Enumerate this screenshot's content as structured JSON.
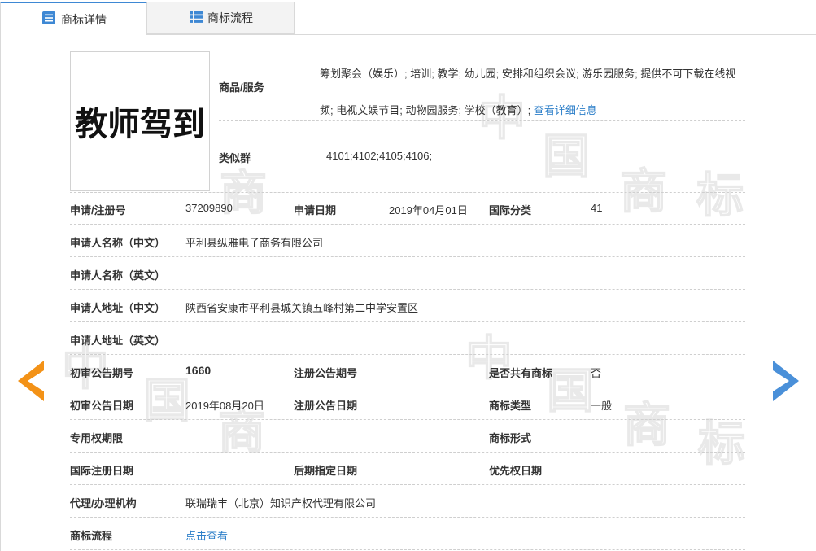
{
  "tabs": [
    {
      "label": "商标详情",
      "icon": "document-list-icon",
      "active": true
    },
    {
      "label": "商标流程",
      "icon": "list-icon",
      "active": false
    }
  ],
  "logo_text": "教师驾到",
  "goods": {
    "label": "商品/服务",
    "text": "筹划聚会（娱乐）; 培训; 教学; 幼儿园; 安排和组织会议; 游乐园服务; 提供不可下载在线视频; 电视文娱节目; 动物园服务; 学校（教育）; ",
    "link": "查看详细信息"
  },
  "similar_group": {
    "label": "类似群",
    "value": "4101;4102;4105;4106;"
  },
  "fields": {
    "reg_no": {
      "label": "申请/注册号",
      "value": "37209890"
    },
    "apply_date": {
      "label": "申请日期",
      "value": "2019年04月01日"
    },
    "intl_class": {
      "label": "国际分类",
      "value": "41"
    },
    "applicant_cn": {
      "label": "申请人名称（中文）",
      "value": "平利县纵雅电子商务有限公司"
    },
    "applicant_en": {
      "label": "申请人名称（英文）",
      "value": ""
    },
    "address_cn": {
      "label": "申请人地址（中文）",
      "value": "陕西省安康市平利县城关镇五峰村第二中学安置区"
    },
    "address_en": {
      "label": "申请人地址（英文）",
      "value": ""
    },
    "prelim_no": {
      "label": "初审公告期号",
      "value": "1660"
    },
    "reg_ann_no": {
      "label": "注册公告期号",
      "value": ""
    },
    "shared": {
      "label": "是否共有商标",
      "value": "否"
    },
    "prelim_date": {
      "label": "初审公告日期",
      "value": "2019年08月20日"
    },
    "reg_ann_date": {
      "label": "注册公告日期",
      "value": ""
    },
    "tm_type": {
      "label": "商标类型",
      "value": "一般"
    },
    "exclusive_period": {
      "label": "专用权期限",
      "value": ""
    },
    "tm_form": {
      "label": "商标形式",
      "value": ""
    },
    "intl_reg_date": {
      "label": "国际注册日期",
      "value": ""
    },
    "later_date": {
      "label": "后期指定日期",
      "value": ""
    },
    "priority_date": {
      "label": "优先权日期",
      "value": ""
    },
    "agent": {
      "label": "代理/办理机构",
      "value": "联瑞瑞丰（北京）知识产权代理有限公司"
    },
    "process": {
      "label": "商标流程",
      "value": "点击查看"
    }
  },
  "watermark": [
    "中",
    "国",
    "商",
    "标"
  ],
  "colors": {
    "accent": "#3e88d4",
    "link": "#2d7fc9",
    "arrow_left": "#f39217",
    "arrow_right": "#4a90d9"
  }
}
